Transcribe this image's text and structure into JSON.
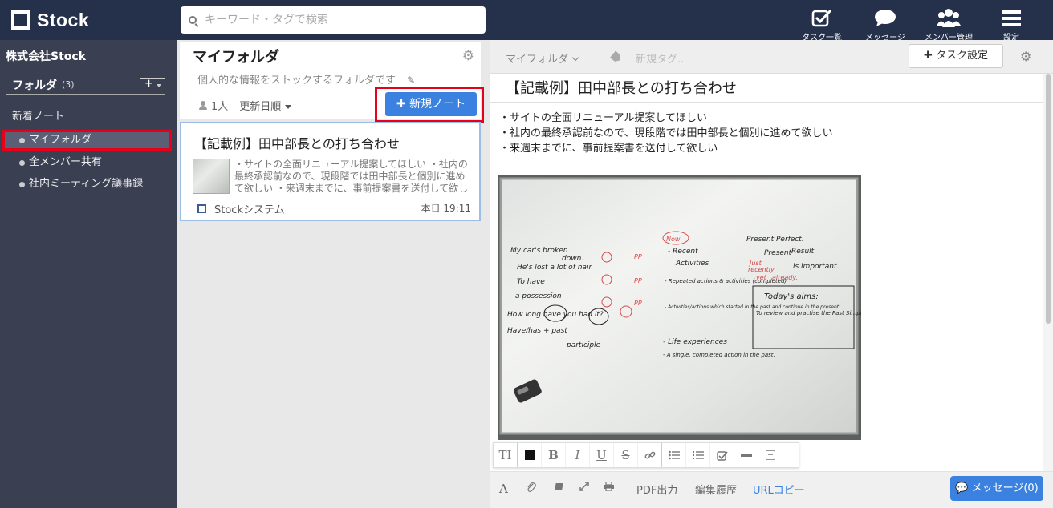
{
  "app": {
    "name": "Stock"
  },
  "search": {
    "placeholder": "キーワード・タグで検索"
  },
  "nav": [
    {
      "label": "タスク一覧",
      "icon": "task-checkbox-icon"
    },
    {
      "label": "メッセージ",
      "icon": "chat-bubble-icon"
    },
    {
      "label": "メンバー管理",
      "icon": "members-icon"
    },
    {
      "label": "設定",
      "icon": "menu-icon"
    }
  ],
  "sidebar": {
    "company": "株式会社Stock",
    "folder_label": "フォルダ",
    "folder_count": "(3)",
    "add_label": "+",
    "new_notes": "新着ノート",
    "items": [
      {
        "label": "マイフォルダ",
        "active": true
      },
      {
        "label": "全メンバー共有",
        "active": false
      },
      {
        "label": "社内ミーティング議事録",
        "active": false
      }
    ]
  },
  "folder": {
    "title": "マイフォルダ",
    "description": "個人的な情報をストックするフォルダです",
    "members": "1人",
    "sort": "更新日順",
    "new_note_button": "新規ノート"
  },
  "note_card": {
    "title": "【記載例】田中部長との打ち合わせ",
    "excerpt": "・サイトの全面リニューアル提案してほしい ・社内の最終承認前なので、現段階では田中部長と個別に進めて欲しい ・来週末までに、事前提案書を送付して欲しい",
    "source": "Stockシステム",
    "date": "本日 19:11"
  },
  "editor": {
    "folder": "マイフォルダ",
    "tag_placeholder": "新規タグ..",
    "task_button": "タスク設定",
    "title": "【記載例】田中部長との打ち合わせ",
    "body": [
      "・サイトの全面リニューアル提案してほしい",
      "・社内の最終承認前なので、現段階では田中部長と個別に進めて欲しい",
      "・来週末までに、事前提案書を送付して欲しい"
    ],
    "bottom": {
      "pdf": "PDF出力",
      "history": "編集履歴",
      "url_copy": "URLコピー",
      "message": "メッセージ(0)"
    }
  },
  "whiteboard_text": [
    "My car's broken",
    "down.",
    "He's lost a lot of hair.",
    "To have",
    "a possession",
    "How long have you had it?",
    "Have/has + past",
    "participle",
    "Now",
    "- Recent",
    "Activities",
    "- Repeated actions & activities (completed)",
    "- Activities/actions which started in the past and continue in the present",
    "- Life experiences",
    "- A single, completed action in the past.",
    "Present Perfect.",
    "Present",
    "Result",
    "is important.",
    "Just",
    "recently",
    "yet",
    "already.",
    "Today's aims:",
    "To review and practise the Past Simple and Present Perfect",
    "PP"
  ],
  "colors": {
    "topbar": "#25304a",
    "sidebar": "#3a3f51",
    "accent": "#3b82e0",
    "highlight": "#e6001a"
  }
}
